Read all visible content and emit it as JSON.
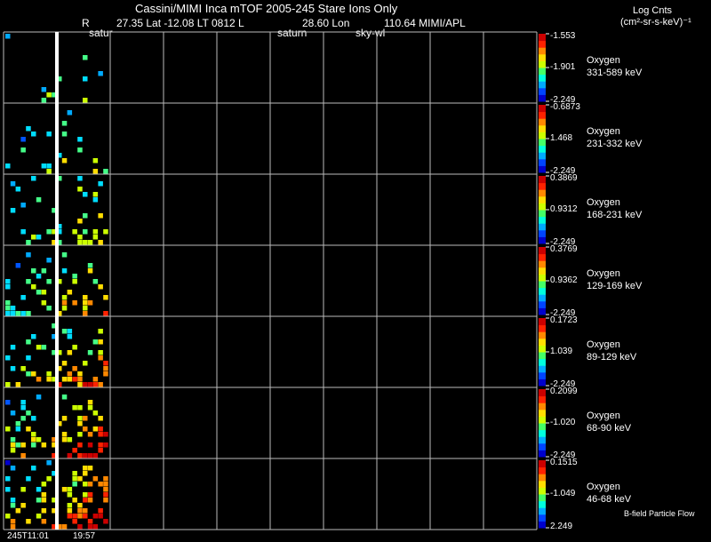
{
  "header": {
    "title": "Cassini/MIMI Inca mTOF  2005-245   Stare   Ions Only",
    "line2_r": "R",
    "line2_main": "27.35 Lat -12.08 LT 0812 L",
    "line2_lon": "28.60 Lon",
    "line2_right": "110.64  MIMI/APL",
    "units_title": "Log Cnts",
    "units_expr": "(cm²-sr-s-keV)⁻¹"
  },
  "markers": {
    "a": "satur",
    "b": "saturn",
    "c": "sky-wl"
  },
  "footer": {
    "t0": "245T11:01",
    "t1": "19:57",
    "legend": "B-field Particle Flow"
  },
  "chart_data": {
    "type": "heatmap",
    "columns": 10,
    "colorbar_colors": [
      "#0000cc",
      "#0044ff",
      "#00aaff",
      "#00ffdd",
      "#44ff66",
      "#ccff00",
      "#ffdd00",
      "#ff8800",
      "#ff2200",
      "#cc0000"
    ],
    "panels": [
      {
        "species": "Oxygen",
        "energy": "331-589 keV",
        "max": "-1.553",
        "mid": "-1.901",
        "min": "-2.249"
      },
      {
        "species": "Oxygen",
        "energy": "231-332 keV",
        "max": "-0.6873",
        "mid": "1.468",
        "min": "-2.249"
      },
      {
        "species": "Oxygen",
        "energy": "168-231 keV",
        "max": "0.3869",
        "mid": "0.9312",
        "min": "-2.249"
      },
      {
        "species": "Oxygen",
        "energy": "129-169 keV",
        "max": "0.3769",
        "mid": "0.9362",
        "min": "-2.249"
      },
      {
        "species": "Oxygen",
        "energy": "89-129 keV",
        "max": "0.1723",
        "mid": "1.039",
        "min": "-2.249"
      },
      {
        "species": "Oxygen",
        "energy": "68-90 keV",
        "max": "0.2099",
        "mid": "-1.020",
        "min": "-2.249"
      },
      {
        "species": "Oxygen",
        "energy": "46-68 keV",
        "max": "0.1515",
        "mid": "-1.049",
        "min": "2.249"
      }
    ]
  }
}
